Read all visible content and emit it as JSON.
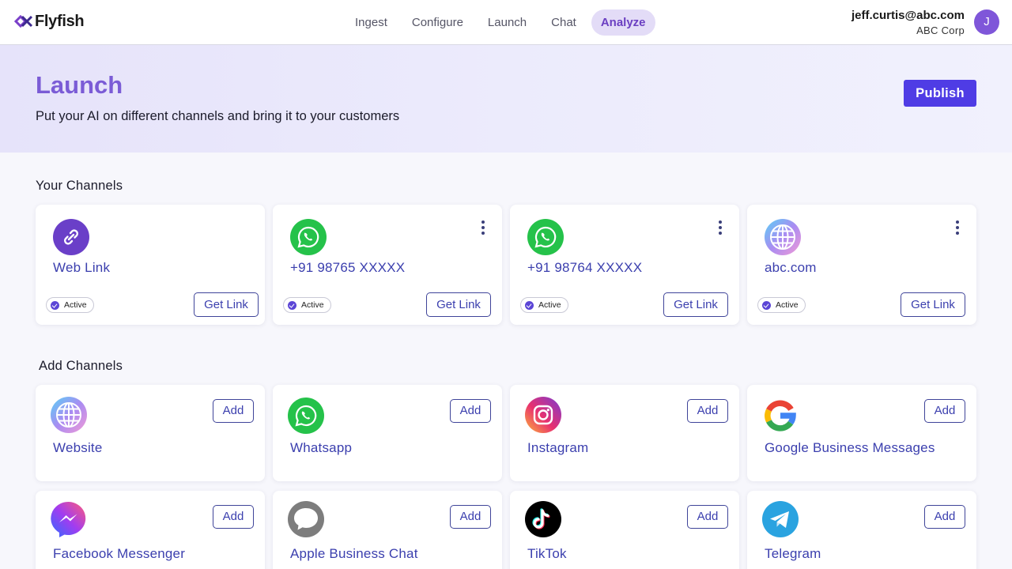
{
  "brand": {
    "name": "Flyfish"
  },
  "nav": {
    "tabs": [
      {
        "label": "Ingest",
        "active": false
      },
      {
        "label": "Configure",
        "active": false
      },
      {
        "label": "Launch",
        "active": false
      },
      {
        "label": "Chat",
        "active": false
      },
      {
        "label": "Analyze",
        "active": true
      }
    ]
  },
  "user": {
    "email": "jeff.curtis@abc.com",
    "org": "ABC Corp",
    "initial": "J"
  },
  "hero": {
    "title": "Launch",
    "subtitle": "Put your AI on different channels and bring it to your customers",
    "publish_label": "Publish"
  },
  "your_channels": {
    "title": "Your Channels",
    "items": [
      {
        "name": "Web Link",
        "icon": "link-icon",
        "status": "Active",
        "action": "Get Link",
        "has_menu": false
      },
      {
        "name": "+91 98765 XXXXX",
        "icon": "whatsapp-icon",
        "status": "Active",
        "action": "Get Link",
        "has_menu": true
      },
      {
        "name": "+91 98764 XXXXX",
        "icon": "whatsapp-icon",
        "status": "Active",
        "action": "Get Link",
        "has_menu": true
      },
      {
        "name": "abc.com",
        "icon": "globe-icon",
        "status": "Active",
        "action": "Get Link",
        "has_menu": true
      }
    ]
  },
  "add_channels": {
    "title": "Add Channels",
    "items": [
      {
        "name": "Website",
        "icon": "globe-icon",
        "action": "Add"
      },
      {
        "name": "Whatsapp",
        "icon": "whatsapp-icon",
        "action": "Add"
      },
      {
        "name": "Instagram",
        "icon": "instagram-icon",
        "action": "Add"
      },
      {
        "name": "Google Business Messages",
        "icon": "google-icon",
        "action": "Add"
      },
      {
        "name": "Facebook Messenger",
        "icon": "messenger-icon",
        "action": "Add"
      },
      {
        "name": "Apple Business Chat",
        "icon": "apple-chat-icon",
        "action": "Add"
      },
      {
        "name": "TikTok",
        "icon": "tiktok-icon",
        "action": "Add"
      },
      {
        "name": "Telegram",
        "icon": "telegram-icon",
        "action": "Add"
      }
    ]
  },
  "colors": {
    "accent": "#4f3ce5",
    "title_purple": "#7b5cd6",
    "link_blue": "#3b3fae",
    "whatsapp_green": "#25d366"
  }
}
